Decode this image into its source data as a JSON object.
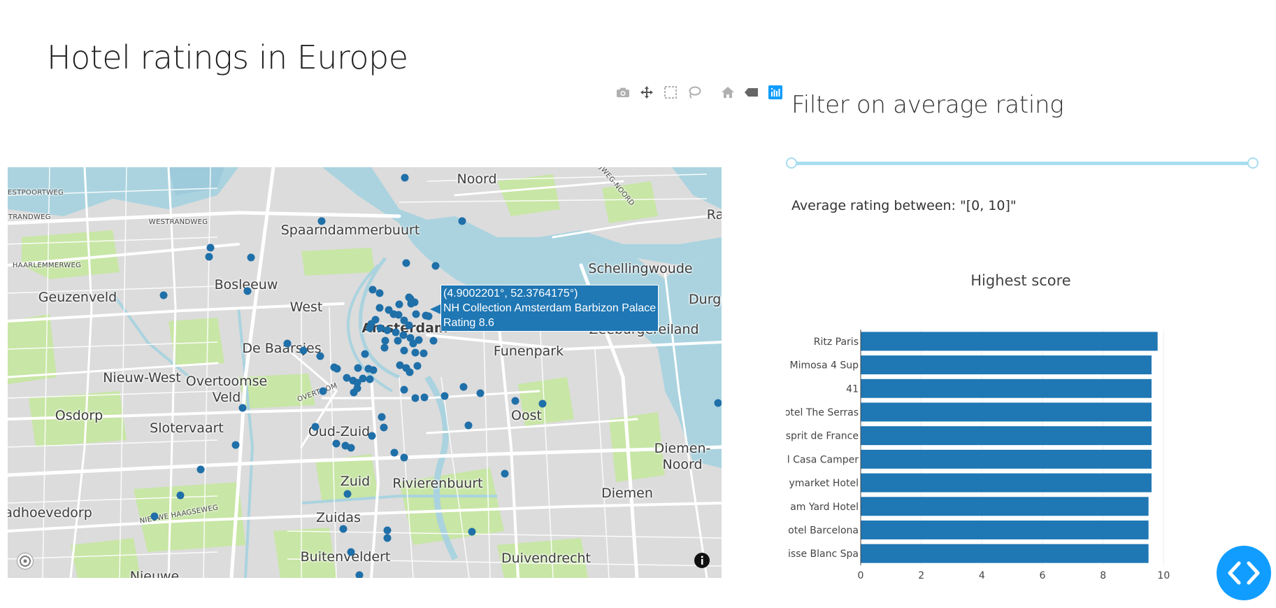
{
  "page": {
    "title": "Hotel ratings in Europe"
  },
  "modebar": {
    "buttons": [
      "camera-icon",
      "pan-icon",
      "box-select-icon",
      "lasso-select-icon",
      "home-icon",
      "tag-icon",
      "plotly-logo-icon"
    ]
  },
  "map": {
    "labels": {
      "noord": "Noord",
      "spaarndammerbuurt": "Spaarndammerbuurt",
      "bosleeuw": "Bosleeuw",
      "geuzenveld": "Geuzenveld",
      "west": "West",
      "amsterdam": "Amsterdam",
      "schellingwoude": "Schellingwoude",
      "durgerdam": "Durge",
      "zeeburgereiland": "Zeeburgereiland",
      "funenpark": "Funenpark",
      "debaarsjes": "De Baarsjes",
      "nieuwwest": "Nieuw-West",
      "overtoomseveld1": "Overtoomse",
      "overtoomseveld2": "Veld",
      "osdorp": "Osdorp",
      "slotervaart": "Slotervaart",
      "oudzuid": "Oud-Zuid",
      "oost": "Oost",
      "diemennoord1": "Diemen-",
      "diemennoord2": "Noord",
      "zuid": "Zuid",
      "rivierenbuurt": "Rivierenbuurt",
      "diemen": "Diemen",
      "badhoevedorp": "adhoevedorp",
      "zuidas": "Zuidas",
      "buitenveldert": "Buitenveldert",
      "duivendrecht": "Duivendrecht",
      "nieuwe": "Nieuwe",
      "ra": "Ra",
      "westpoortweg": "ESTPOORTWEG",
      "westrandweg": "WESTRANDWEG",
      "westrandweg2": "STRANDWEG",
      "haarlemmerweg": "HAARLEMMERWEG",
      "overtoom": "OVERTOOM",
      "nieuwehaagseweg": "NIEUWE HAAGSEWEG",
      "ijwegnoord": "IJWEG-NOORD"
    },
    "tooltip": {
      "coords": "(4.9002201°, 52.3764175°)",
      "name": "NH Collection Amsterdam Barbizon Palace",
      "rating": "Rating 8.6"
    },
    "marker_color": "#1f6fa8"
  },
  "filter": {
    "title": "Filter on average rating",
    "range_text": "Average rating between: \"[0, 10]\"",
    "slider": {
      "min": 0,
      "max": 10,
      "value": [
        0,
        10
      ]
    }
  },
  "chart_data": {
    "type": "bar",
    "orientation": "horizontal",
    "title": "Highest score",
    "categories": [
      "Ritz Paris",
      "Mimosa 4 Sup",
      "41",
      "otel The Serras",
      "sprit de France",
      "l Casa Camper",
      "ymarket Hotel",
      "am Yard Hotel",
      "otel Barcelona",
      "isse Blanc Spa"
    ],
    "values": [
      9.8,
      9.6,
      9.6,
      9.6,
      9.6,
      9.6,
      9.6,
      9.5,
      9.5,
      9.5
    ],
    "xlim": [
      0,
      10.5
    ],
    "xticks": [
      0,
      2,
      4,
      6,
      8,
      10
    ],
    "color": "#1f77b4",
    "grid": true
  },
  "colors": {
    "accent": "#119dff",
    "bar": "#1f77b4",
    "slider": "#a8ddf0"
  }
}
